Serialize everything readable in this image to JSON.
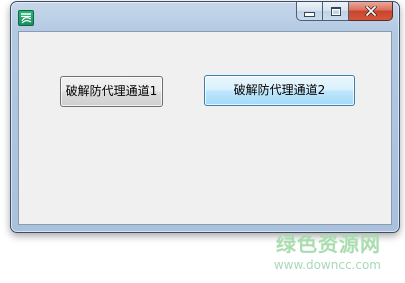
{
  "window": {
    "icon": "app-icon",
    "caption_buttons": [
      "minimize-icon",
      "maximize-icon",
      "close-icon"
    ]
  },
  "buttons": {
    "channel1_label": "破解防代理通道1",
    "channel2_label": "破解防代理通道2"
  },
  "watermark": {
    "site_name": "绿色资源网",
    "url": "www.downcc.com"
  }
}
